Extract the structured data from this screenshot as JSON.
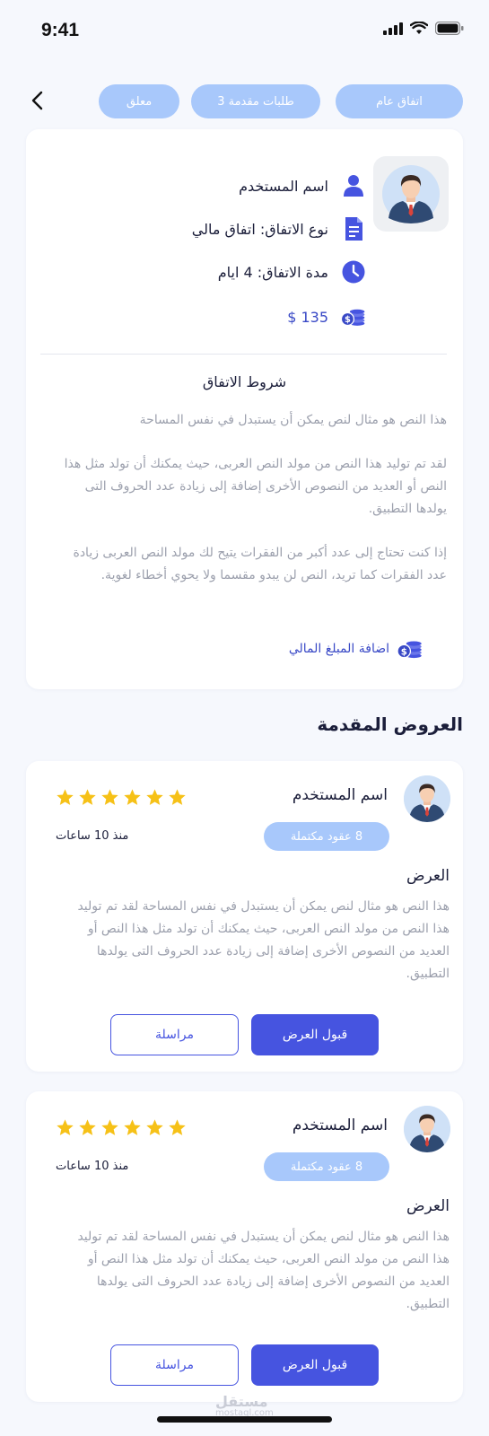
{
  "status_bar": {
    "time": "9:41"
  },
  "top_nav": {
    "tabs": [
      {
        "label": "اتفاق عام"
      },
      {
        "label": "طلبات مقدمة 3"
      },
      {
        "label": "معلق"
      }
    ]
  },
  "agreement": {
    "user_name": "اسم المستخدم",
    "agreement_type": "نوع الاتفاق: اتفاق مالي",
    "duration": "مدة الاتفاق: 4 ايام",
    "price": "135 $",
    "terms_title": "شروط الاتفاق",
    "terms_paragraphs": [
      "هذا النص هو مثال لنص يمكن أن يستبدل في نفس المساحة",
      "لقد تم توليد هذا النص من مولد النص العربى، حيث يمكنك أن تولد مثل هذا النص أو العديد من النصوص الأخرى إضافة إلى زيادة عدد الحروف التى يولدها التطبيق.",
      "إذا كنت تحتاج إلى عدد أكبر من الفقرات يتيح لك مولد النص العربى زيادة عدد الفقرات كما تريد، النص لن يبدو مقسما ولا يحوي أخطاء لغوية."
    ],
    "add_amount_label": "اضافة المبلغ المالي"
  },
  "offers_section": {
    "title": "العروض المقدمة",
    "offers": [
      {
        "user_name": "اسم المستخدم",
        "rating": 5,
        "completed_contracts": "8   عقود مكتملة",
        "time_ago": "منذ 10 ساعات",
        "offer_label": "العرض",
        "offer_text": "هذا النص هو مثال لنص يمكن أن يستبدل في نفس المساحة لقد تم توليد هذا النص من مولد النص العربى، حيث يمكنك أن تولد مثل هذا النص أو العديد من النصوص الأخرى إضافة إلى زيادة عدد الحروف التى يولدها التطبيق.",
        "accept_label": "قبول العرض",
        "message_label": "مراسلة"
      },
      {
        "user_name": "اسم المستخدم",
        "rating": 5,
        "completed_contracts": "8   عقود مكتملة",
        "time_ago": "منذ 10 ساعات",
        "offer_label": "العرض",
        "offer_text": "هذا النص هو مثال لنص يمكن أن يستبدل في نفس المساحة لقد تم توليد هذا النص من مولد النص العربى، حيث يمكنك أن تولد مثل هذا النص أو العديد من النصوص الأخرى إضافة إلى زيادة عدد الحروف التى يولدها التطبيق.",
        "accept_label": "قبول العرض",
        "message_label": "مراسلة"
      }
    ]
  },
  "watermark": {
    "text": "مستقل",
    "sub": "mostaql.com"
  },
  "icons": {
    "back": "chevron-left-icon",
    "user": "user-icon",
    "document": "document-icon",
    "clock": "clock-icon",
    "coins": "coins-icon",
    "star": "star-icon"
  },
  "colors": {
    "accent": "#4654e0",
    "pill": "#a8c8fb",
    "star": "#f6c117",
    "price": "#3949c6"
  }
}
